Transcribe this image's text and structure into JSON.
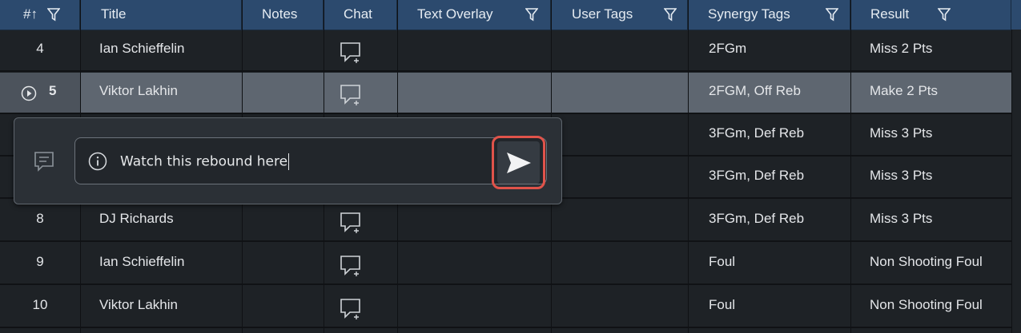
{
  "header": {
    "num": "#",
    "sort_arrow": "↑",
    "title": "Title",
    "notes": "Notes",
    "chat": "Chat",
    "text_overlay": "Text Overlay",
    "user_tags": "User Tags",
    "synergy_tags": "Synergy Tags",
    "result": "Result"
  },
  "rows": [
    {
      "num": "4",
      "title": "Ian Schieffelin",
      "synergy": "2FGm",
      "result": "Miss 2 Pts"
    },
    {
      "num": "5",
      "title": "Viktor Lakhin",
      "synergy": "2FGM, Off Reb",
      "result": "Make 2 Pts"
    },
    {
      "num": "",
      "title": "",
      "synergy": "3FGm, Def Reb",
      "result": "Miss 3 Pts"
    },
    {
      "num": "",
      "title": "",
      "synergy": "3FGm, Def Reb",
      "result": "Miss 3 Pts"
    },
    {
      "num": "8",
      "title": "DJ Richards",
      "synergy": "3FGm, Def Reb",
      "result": "Miss 3 Pts"
    },
    {
      "num": "9",
      "title": "Ian Schieffelin",
      "synergy": "Foul",
      "result": "Non Shooting Foul"
    },
    {
      "num": "10",
      "title": "Viktor Lakhin",
      "synergy": "Foul",
      "result": "Non Shooting Foul"
    }
  ],
  "comment_popup": {
    "input_value": "Watch this rebound here"
  },
  "colors": {
    "header_bg": "#2c4a6e",
    "row_bg": "#1e2226",
    "selected_row_bg": "#5e6670",
    "send_highlight": "#e0534a"
  },
  "icons": {
    "filter": "filter-icon",
    "chat": "chat-add-icon",
    "play": "play-circle-icon",
    "comment": "comment-icon",
    "info": "info-icon",
    "send": "send-icon"
  }
}
